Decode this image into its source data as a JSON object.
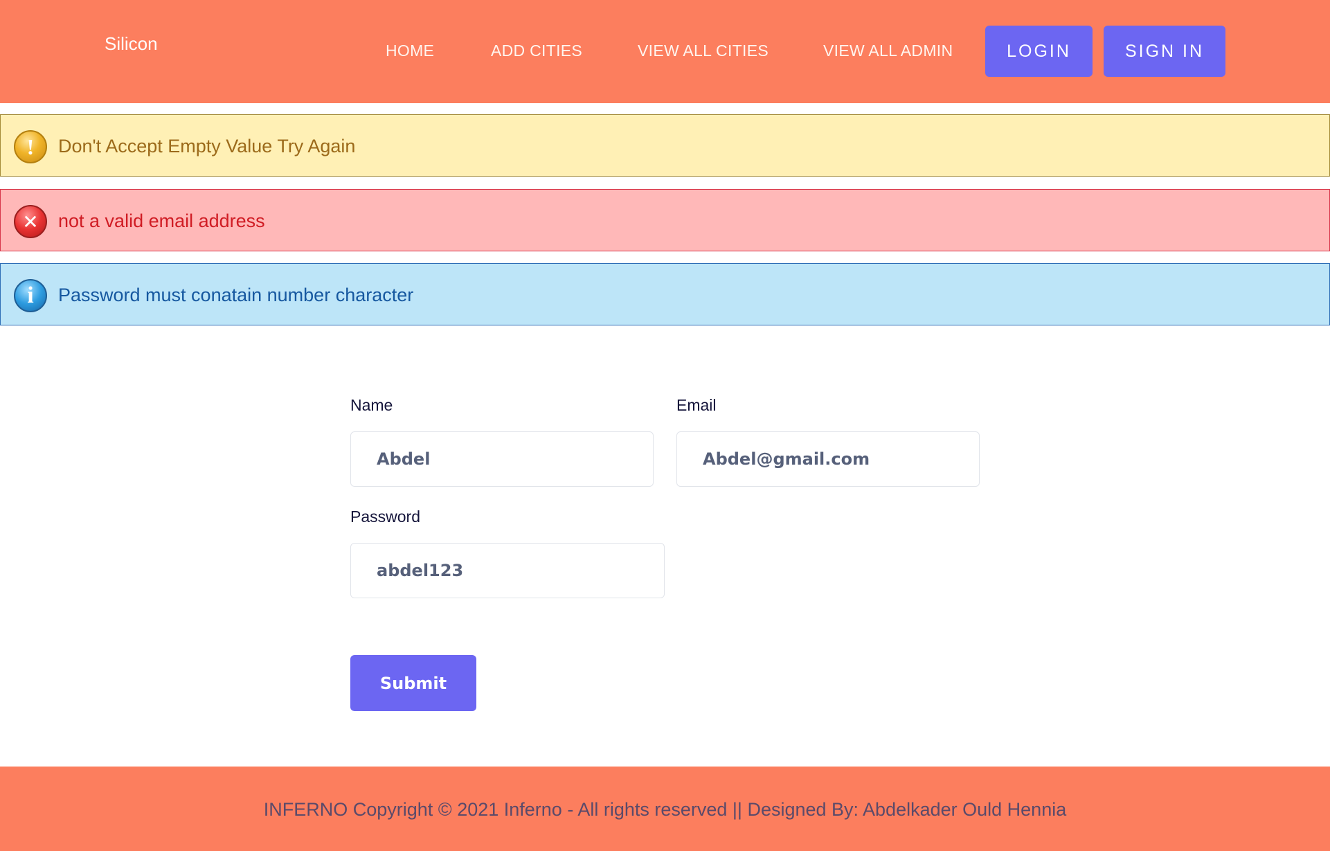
{
  "header": {
    "brand": "Silicon",
    "nav": {
      "home": "HOME",
      "add_cities": "ADD CITIES",
      "view_all_cities": "VIEW ALL CITIES",
      "view_all_admin": "VIEW ALL ADMIN"
    },
    "login_label": "LOGIN",
    "signin_label": "SIGN IN"
  },
  "alerts": {
    "warning": {
      "icon": "warning-icon",
      "message": "Don't Accept Empty Value Try Again"
    },
    "error": {
      "icon": "error-icon",
      "message": "not a valid email address"
    },
    "info": {
      "icon": "info-icon",
      "message": "Password must conatain number character"
    }
  },
  "form": {
    "name_label": "Name",
    "name_value": "Abdel",
    "email_label": "Email",
    "email_value": "Abdel@gmail.com",
    "password_label": "Password",
    "password_value": "abdel123",
    "submit_label": "Submit"
  },
  "footer": {
    "text": "INFERNO Copyright © 2021 Inferno - All rights reserved || Designed By: Abdelkader Ould Hennia"
  },
  "colors": {
    "header_bg": "#fc7e5e",
    "accent": "#6c66f2",
    "warning_bg": "#fff0b5",
    "error_bg": "#ffb8b8",
    "info_bg": "#bde5f8"
  }
}
